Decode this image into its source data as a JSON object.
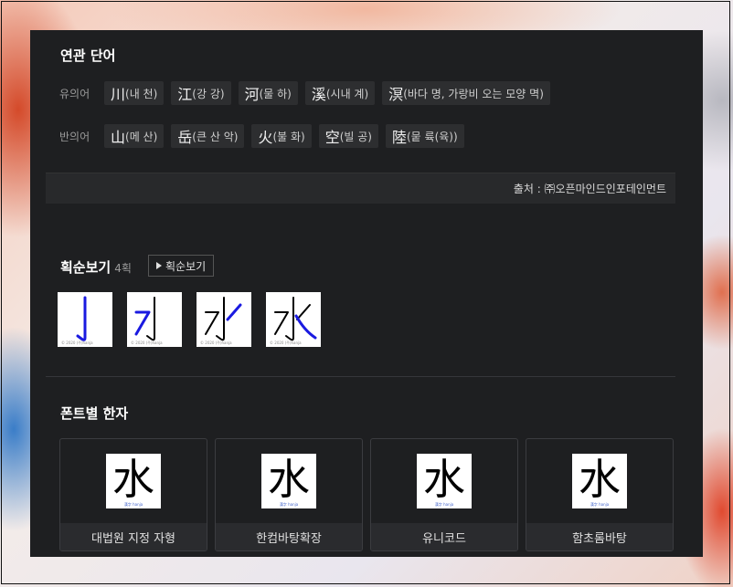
{
  "related": {
    "title": "연관 단어",
    "synonym_label": "유의어",
    "synonyms": [
      {
        "hanja": "川",
        "reading": "(내 천)"
      },
      {
        "hanja": "江",
        "reading": "(강 강)"
      },
      {
        "hanja": "河",
        "reading": "(물 하)"
      },
      {
        "hanja": "溪",
        "reading": "(시내 계)"
      },
      {
        "hanja": "溟",
        "reading": "(바다 명, 가랑비 오는 모양 멱)"
      }
    ],
    "antonym_label": "반의어",
    "antonyms": [
      {
        "hanja": "山",
        "reading": "(메 산)"
      },
      {
        "hanja": "岳",
        "reading": "(큰 산 악)"
      },
      {
        "hanja": "火",
        "reading": "(불 화)"
      },
      {
        "hanja": "空",
        "reading": "(빌 공)"
      },
      {
        "hanja": "陸",
        "reading": "(뭍 륙(육))"
      }
    ],
    "source": "출처 : ㈜오픈마인드인포테인먼트"
  },
  "strokes": {
    "title": "획순보기",
    "count": "4획",
    "button_label": "획순보기",
    "frames": [
      "stroke-1",
      "stroke-2",
      "stroke-3",
      "stroke-4"
    ],
    "copyright": "© 2020 (주)hanja"
  },
  "fonts": {
    "title": "폰트별 한자",
    "glyph": "水",
    "watermark": "漢字 hanja",
    "cards": [
      {
        "name": "대법원 지정 자형"
      },
      {
        "name": "한컴바탕확장"
      },
      {
        "name": "유니코드"
      },
      {
        "name": "함초롬바탕"
      }
    ]
  },
  "colors": {
    "panel": "#1e1f21",
    "chip": "#2d2e30",
    "stroke_blue": "#1a1ae0"
  }
}
